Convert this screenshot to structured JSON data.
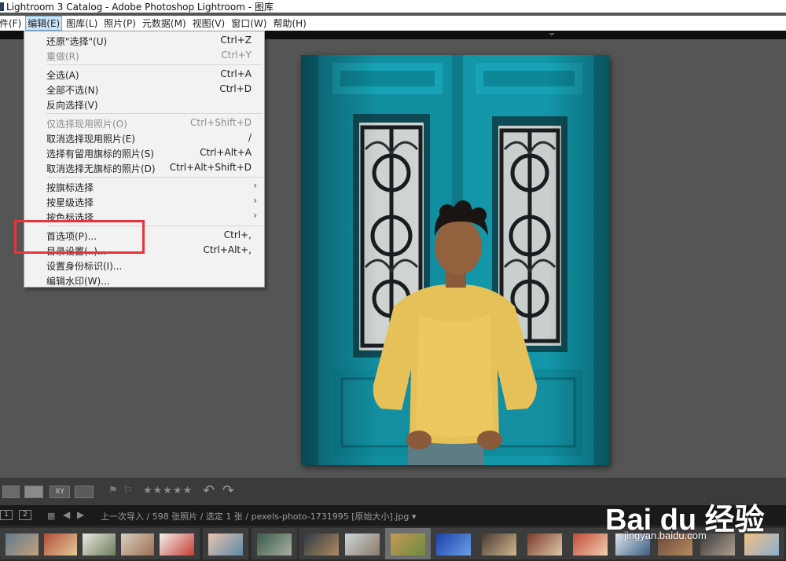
{
  "window": {
    "title": "Lightroom 3 Catalog - Adobe Photoshop Lightroom - 图库"
  },
  "menubar": {
    "items": [
      {
        "label": "件(F)"
      },
      {
        "label": "编辑(E)",
        "active": true
      },
      {
        "label": "图库(L)"
      },
      {
        "label": "照片(P)"
      },
      {
        "label": "元数据(M)"
      },
      {
        "label": "视图(V)"
      },
      {
        "label": "窗口(W)"
      },
      {
        "label": "帮助(H)"
      }
    ]
  },
  "edit_menu": {
    "items": [
      {
        "label": "还原\"选择\"(U)",
        "shortcut": "Ctrl+Z"
      },
      {
        "label": "重做(R)",
        "shortcut": "Ctrl+Y",
        "disabled": true
      },
      {
        "label": "全选(A)",
        "shortcut": "Ctrl+A"
      },
      {
        "label": "全部不选(N)",
        "shortcut": "Ctrl+D"
      },
      {
        "label": "反向选择(V)",
        "shortcut": ""
      },
      {
        "label": "仅选择现用照片(O)",
        "shortcut": "Ctrl+Shift+D",
        "disabled": true
      },
      {
        "label": "取消选择现用照片(E)",
        "shortcut": "/"
      },
      {
        "label": "选择有留用旗标的照片(S)",
        "shortcut": "Ctrl+Alt+A"
      },
      {
        "label": "取消选择无旗标的照片(D)",
        "shortcut": "Ctrl+Alt+Shift+D"
      },
      {
        "label": "按旗标选择",
        "submenu": true
      },
      {
        "label": "按星级选择",
        "submenu": true
      },
      {
        "label": "按色标选择",
        "submenu": true
      },
      {
        "label": "首选项(P)...",
        "shortcut": "Ctrl+,"
      },
      {
        "label": "目录设置(..)...",
        "shortcut": "Ctrl+Alt+,"
      },
      {
        "label": "设置身份标识(I)...",
        "shortcut": ""
      },
      {
        "label": "编辑水印(W)...",
        "shortcut": ""
      }
    ],
    "submenu_arrow": "›"
  },
  "toolbar": {
    "stars": "★★★★★",
    "view_compare": "XY"
  },
  "infobar": {
    "page1": "1",
    "page2": "2",
    "source": "上一次导入 / 598 张照片 / 选定 1 张 / pexels-photo-1731995 [原始大小].jpg ▾"
  },
  "filmstrip": {
    "selected_index": 9
  },
  "watermark": {
    "brand": "Bai du 经验",
    "url": "jingyan.baidu.com"
  },
  "colors": {
    "accent_highlight": "#e5343e",
    "teal_door": "#0f8fa3",
    "shirt_yellow": "#e6c15a"
  }
}
